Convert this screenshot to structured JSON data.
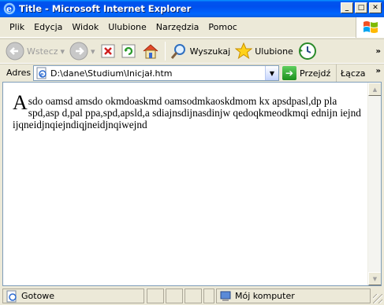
{
  "window": {
    "title": "Title - Microsoft Internet Explorer",
    "minimize_icon": "minimize-icon",
    "maximize_icon": "maximize-icon",
    "close_icon": "close-icon"
  },
  "menu": {
    "items": [
      {
        "label": "Plik"
      },
      {
        "label": "Edycja"
      },
      {
        "label": "Widok"
      },
      {
        "label": "Ulubione"
      },
      {
        "label": "Narzędzia"
      },
      {
        "label": "Pomoc"
      }
    ]
  },
  "toolbar": {
    "back_label": "Wstecz",
    "search_label": "Wyszukaj",
    "favorites_label": "Ulubione"
  },
  "address": {
    "label": "Adres",
    "value": "D:\\dane\\Studium\\Inicjał.htm",
    "go_label": "Przejdź",
    "links_label": "Łącza"
  },
  "document": {
    "dropcap": "A",
    "text": "sdo oamsd amsdo okmdoaskmd oamsodmkaoskdmom kx apsdpasl,dp pla spd,asp d,pal ppa,spd,apsld,a sdiajnsdijnasdinjw qedoqkmeodkmqi ednijn iejnd ijqneidjnqiejndiqjneidjnqiwejnd"
  },
  "status": {
    "left_text": "Gotowe",
    "zone_text": "Mój komputer"
  },
  "colors": {
    "titlebar": "#0054E3",
    "chrome": "#ECE9D8",
    "border": "#7F9DB9"
  }
}
